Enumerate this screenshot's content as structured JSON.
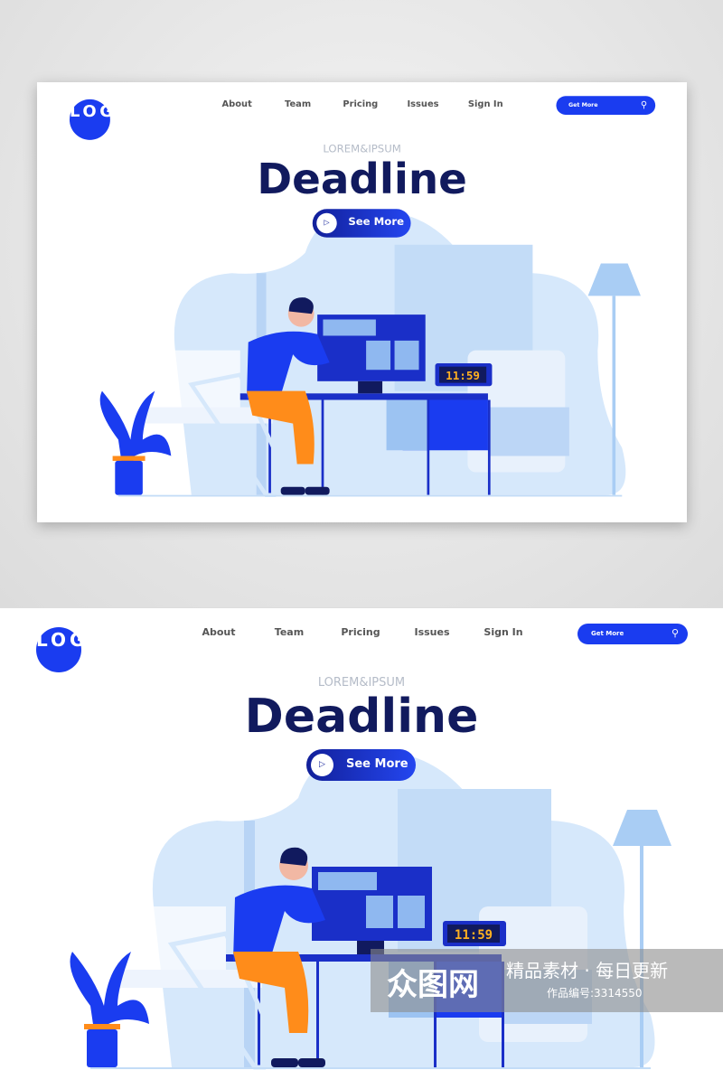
{
  "logo": {
    "text": "LOGO"
  },
  "nav": {
    "items": [
      "About",
      "Team",
      "Pricing",
      "Issues",
      "Sign In"
    ]
  },
  "search": {
    "label": "Get More",
    "icon": "search-icon"
  },
  "hero": {
    "eyebrow": "LOREM&IPSUM",
    "title": "Deadline",
    "cta": "See More",
    "cta_icon": "play-icon"
  },
  "illustration": {
    "clock": "11:59"
  },
  "watermark": {
    "brand": "众图网",
    "tagline": "精品素材 · 每日更新",
    "id": "作品编号:3314550"
  },
  "colors": {
    "primary": "#1a3cf0",
    "title": "#111a5e",
    "light": "#d6e8fb"
  }
}
